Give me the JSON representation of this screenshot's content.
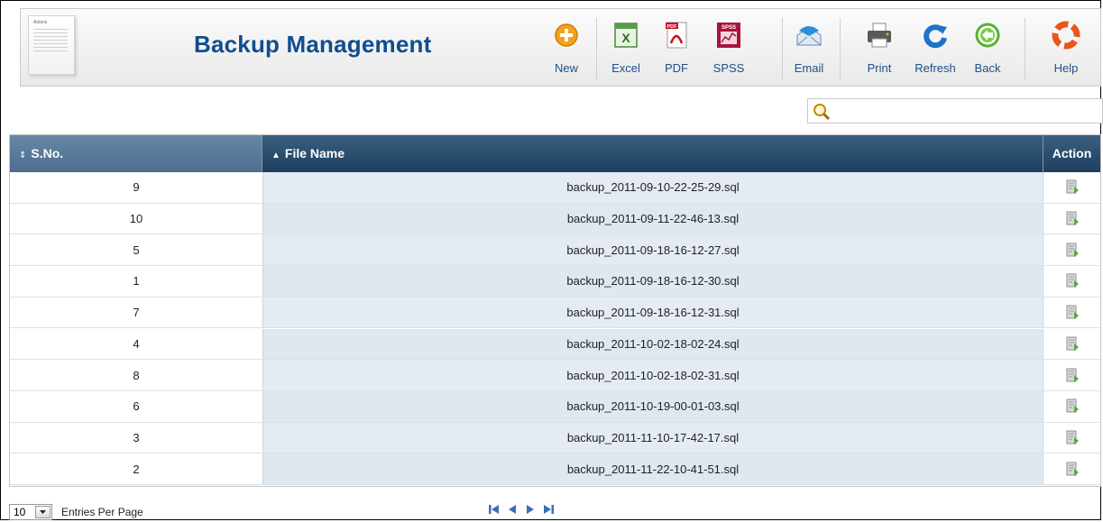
{
  "header": {
    "title": "Backup Management",
    "doc_thumb_title": "Artisns",
    "toolbar": [
      {
        "id": "new",
        "label": "New",
        "icon": "plus-circle-icon"
      },
      {
        "id": "excel",
        "label": "Excel",
        "icon": "excel-icon"
      },
      {
        "id": "pdf",
        "label": "PDF",
        "icon": "pdf-icon"
      },
      {
        "id": "spss",
        "label": "SPSS",
        "icon": "spss-icon"
      },
      {
        "id": "email",
        "label": "Email",
        "icon": "email-icon"
      },
      {
        "id": "print",
        "label": "Print",
        "icon": "printer-icon"
      },
      {
        "id": "refresh",
        "label": "Refresh",
        "icon": "refresh-icon"
      },
      {
        "id": "back",
        "label": "Back",
        "icon": "back-arrow-icon"
      },
      {
        "id": "help",
        "label": "Help",
        "icon": "lifebuoy-icon"
      }
    ]
  },
  "search": {
    "value": "",
    "placeholder": ""
  },
  "table": {
    "columns": {
      "sno": "S.No.",
      "file_name": "File Name",
      "action": "Action"
    },
    "sort_glyphs": {
      "sno": "⇕",
      "file_name": "▲"
    },
    "rows": [
      {
        "sno": "9",
        "file": "backup_2011-09-10-22-25-29.sql"
      },
      {
        "sno": "10",
        "file": "backup_2011-09-11-22-46-13.sql"
      },
      {
        "sno": "5",
        "file": "backup_2011-09-18-16-12-27.sql"
      },
      {
        "sno": "1",
        "file": "backup_2011-09-18-16-12-30.sql"
      },
      {
        "sno": "7",
        "file": "backup_2011-09-18-16-12-31.sql"
      },
      {
        "sno": "4",
        "file": "backup_2011-10-02-18-02-24.sql"
      },
      {
        "sno": "8",
        "file": "backup_2011-10-02-18-02-31.sql"
      },
      {
        "sno": "6",
        "file": "backup_2011-10-19-00-01-03.sql"
      },
      {
        "sno": "3",
        "file": "backup_2011-11-10-17-42-17.sql"
      },
      {
        "sno": "2",
        "file": "backup_2011-11-22-10-41-51.sql"
      }
    ]
  },
  "footer": {
    "per_page": "10",
    "per_page_label": "Entries Per Page"
  },
  "colors": {
    "title": "#0f4e8f",
    "header_dark": "#1f3f5f",
    "row_alt": "#e4ebf2"
  }
}
